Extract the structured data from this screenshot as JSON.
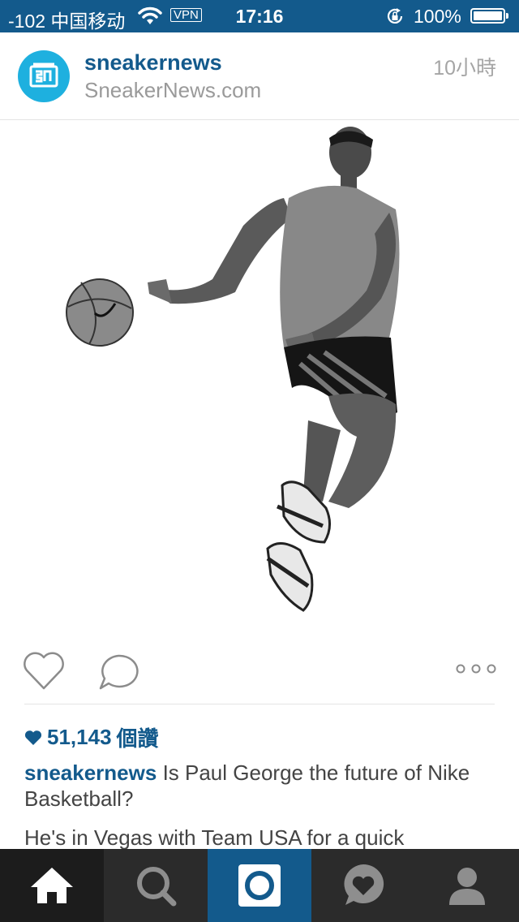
{
  "status_bar": {
    "carrier": "-102 中国移动",
    "vpn": "VPN",
    "time": "17:16",
    "battery": "100%"
  },
  "post": {
    "username": "sneakernews",
    "location": "SneakerNews.com",
    "time_ago": "10小時",
    "likes_count": "51,143",
    "likes_suffix": "個讚",
    "caption_user": "sneakernews",
    "caption_text": "Is Paul George the future of Nike Basketball?",
    "comment_text": "He's in Vegas with Team USA for a quick"
  },
  "icons": {
    "like": "heart-outline-icon",
    "comment": "speech-bubble-icon",
    "more": "three-dots-icon",
    "home": "home-icon",
    "explore": "search-icon",
    "camera": "camera-icon",
    "activity": "heart-bubble-icon",
    "profile": "person-icon"
  },
  "colors": {
    "brand_blue": "#135a8c",
    "avatar_cyan": "#1eb0df",
    "tabbar": "#2b2b2b"
  }
}
